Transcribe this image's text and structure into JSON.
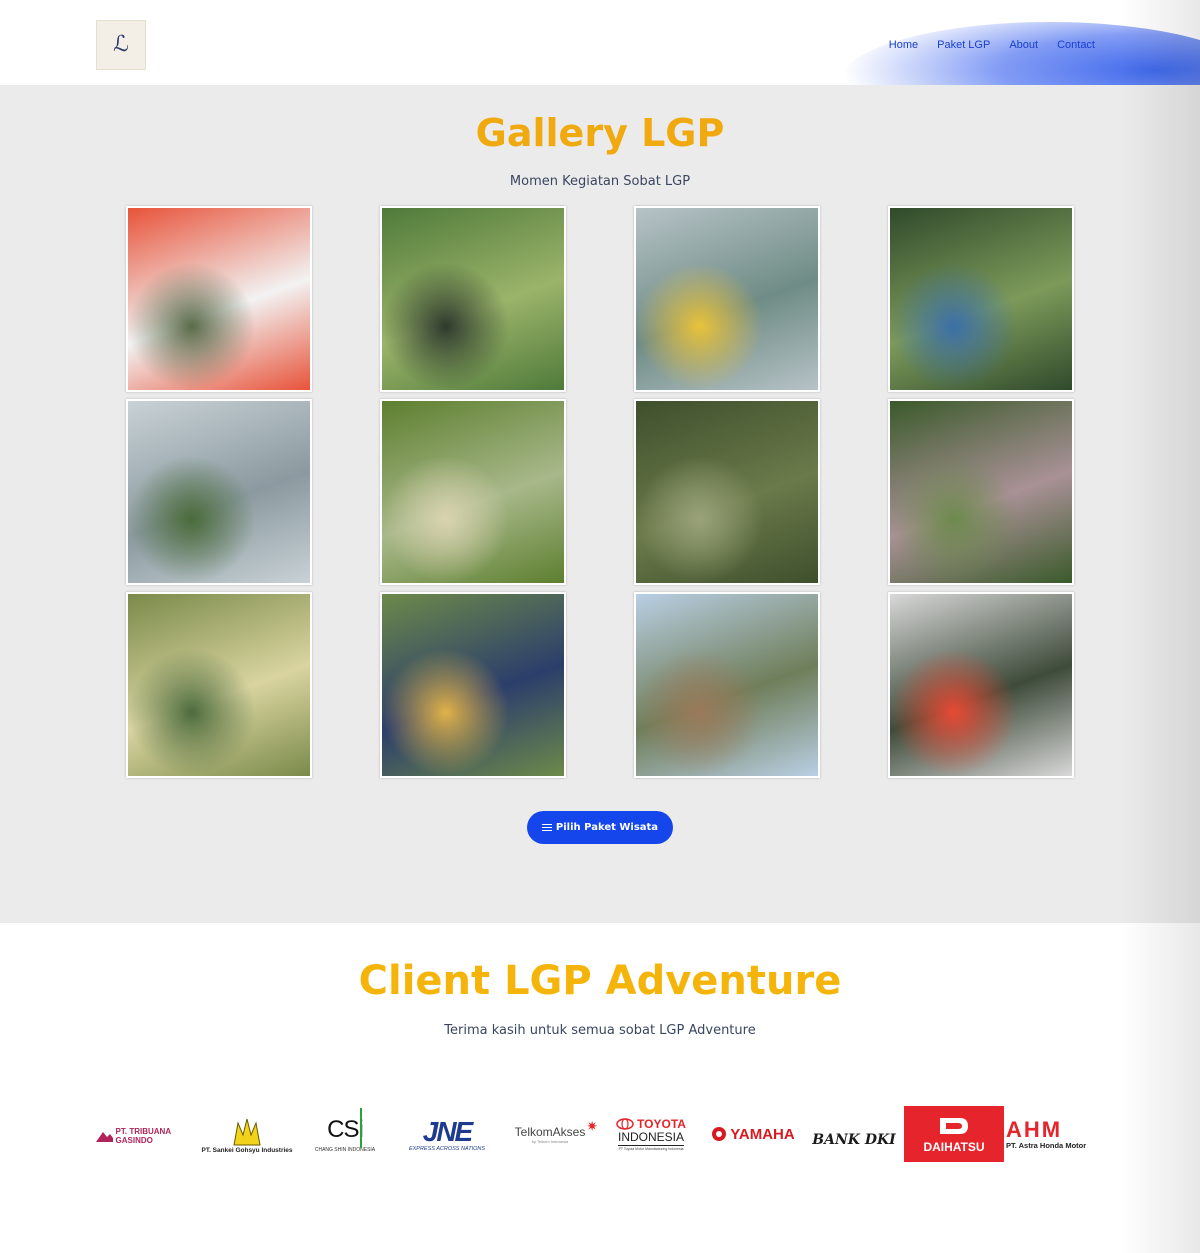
{
  "header": {
    "logo_alt": "LGP Adventure",
    "nav": [
      "Home",
      "Paket LGP",
      "About",
      "Contact"
    ]
  },
  "gallery": {
    "title": "Gallery LGP",
    "subtitle": "Momen Kegiatan Sobat LGP",
    "button_label": "Pilih Paket Wisata",
    "photos": [
      {
        "name": "rafting-raft-closeup",
        "colors": [
          "#e8533a",
          "#f2f2f2",
          "#5a6b4a"
        ]
      },
      {
        "name": "outbound-group-field",
        "colors": [
          "#4f7a3a",
          "#9bb46a",
          "#2e3a2e"
        ]
      },
      {
        "name": "lake-boats",
        "colors": [
          "#b7c3c7",
          "#6f8c86",
          "#e9c23a"
        ]
      },
      {
        "name": "camping-forest-tents",
        "colors": [
          "#2f4a2b",
          "#7d9a5a",
          "#3b6fa8"
        ]
      },
      {
        "name": "flying-fox-lake",
        "colors": [
          "#c9d2d6",
          "#8b9aa0",
          "#4a6b3a"
        ]
      },
      {
        "name": "offroad-jeep",
        "colors": [
          "#5d7f2f",
          "#a8b88a",
          "#d9d3b0"
        ]
      },
      {
        "name": "paintball-forest",
        "colors": [
          "#3e4f2c",
          "#6b7a4a",
          "#9aa37a"
        ]
      },
      {
        "name": "paintball-pine-forest",
        "colors": [
          "#3a5a2a",
          "#a99196",
          "#6c8a4c"
        ]
      },
      {
        "name": "boat-on-lake",
        "colors": [
          "#7a8a4a",
          "#d9d4a0",
          "#4c6b3c"
        ]
      },
      {
        "name": "group-photo-sign",
        "colors": [
          "#6c8a4a",
          "#2c3e6b",
          "#e0b248"
        ]
      },
      {
        "name": "group-photo-path",
        "colors": [
          "#b9cfe4",
          "#6f7e5a",
          "#9a7a5a"
        ]
      },
      {
        "name": "rafting-river",
        "colors": [
          "#d8d8d8",
          "#3e4b3a",
          "#e74a34"
        ]
      }
    ]
  },
  "clients": {
    "title": "Client LGP Adventure",
    "subtitle": "Terima kasih untuk semua sobat LGP Adventure",
    "logos": [
      {
        "name": "tribuana-gasindo",
        "text": "PT. TRIBUANA GASINDO"
      },
      {
        "name": "sankei-gohsyu",
        "text": "PT. Sankei Gohsyu Industries"
      },
      {
        "name": "chang-shin",
        "mark": "CSi",
        "text": "CHANG SHIN INDONESIA"
      },
      {
        "name": "jne",
        "mark": "JNE",
        "text": "EXPRESS ACROSS NATIONS"
      },
      {
        "name": "telkom-akses",
        "mark": "TelkomAkses",
        "text": "by Telkom Indonesia"
      },
      {
        "name": "toyota-indonesia",
        "mark": "TOYOTA",
        "text": "INDONESIA",
        "small": "PT Toyota Motor Manufacturing Indonesia"
      },
      {
        "name": "yamaha",
        "text": "YAMAHA"
      },
      {
        "name": "bank-dki",
        "text": "BANK DKI"
      },
      {
        "name": "daihatsu",
        "text": "DAIHATSU"
      },
      {
        "name": "astra-honda",
        "mark": "AHM",
        "text": "PT. Astra Honda Motor"
      }
    ]
  },
  "colors": {
    "accent_title": "#f0a90e",
    "nav_link": "#1a3fcf",
    "button": "#1546ec",
    "gallery_bg": "#ebebeb"
  }
}
